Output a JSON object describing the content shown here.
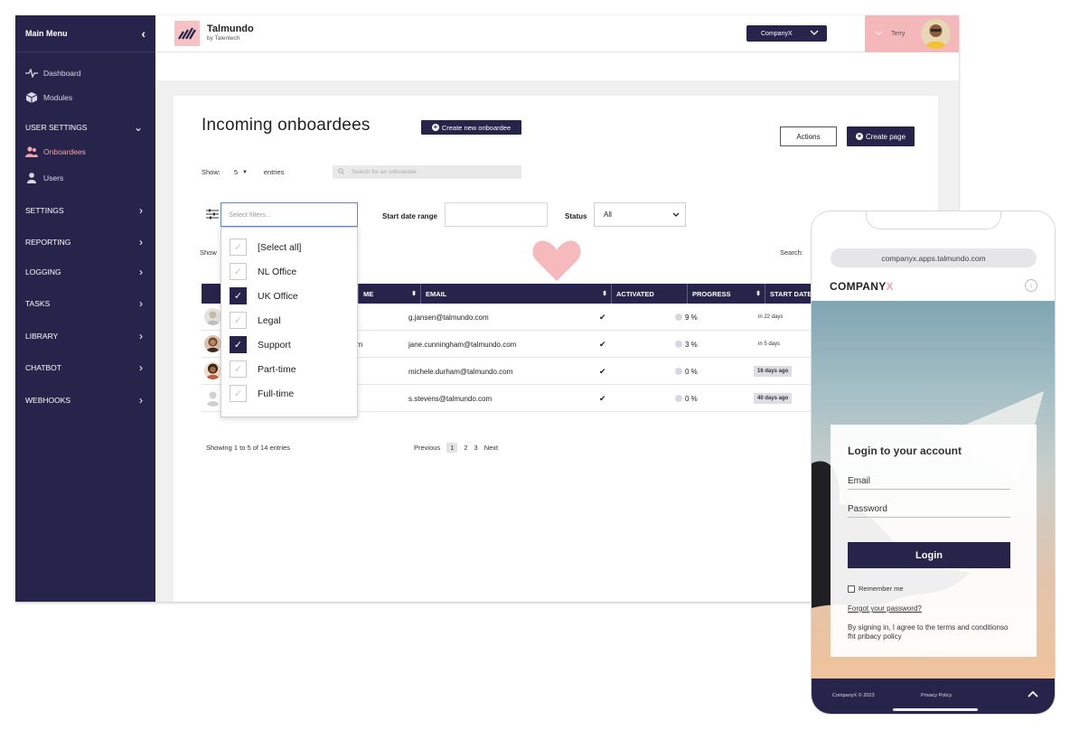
{
  "sidebar": {
    "title": "Main Menu",
    "items": [
      {
        "label": "Dashboard",
        "icon": "pulse-icon"
      },
      {
        "label": "Modules",
        "icon": "cube-icon"
      },
      {
        "label": "USER SETTINGS",
        "expanded": true
      },
      {
        "label": "Onboardees",
        "icon": "users-icon",
        "active": true
      },
      {
        "label": "Users",
        "icon": "user-icon"
      },
      {
        "label": "SETTINGS"
      },
      {
        "label": "REPORTING"
      },
      {
        "label": "LOGGING"
      },
      {
        "label": "TASKS"
      },
      {
        "label": "LIBRARY"
      },
      {
        "label": "CHATBOT"
      },
      {
        "label": "WEBHOOKS"
      }
    ]
  },
  "topbar": {
    "brand": "Talmundo",
    "brand_sub": "by Talentech",
    "company": "CompanyX",
    "user": "Terry"
  },
  "main": {
    "title": "Incoming onboardees",
    "create_onboardee": "Create new onboardee",
    "actions": "Actions",
    "create_page": "Create page",
    "show_label": "Show:",
    "show_value": "5",
    "entries_label": "entries",
    "search_placeholder": "Search for an onboardee",
    "filter_placeholder": "Select filters...",
    "start_date_label": "Start date range",
    "status_label": "Status",
    "status_value": "All",
    "show_partial": "Show",
    "search_label": "Search:"
  },
  "filter_options": [
    {
      "label": "[Select all]",
      "checked": false
    },
    {
      "label": "NL Office",
      "checked": false
    },
    {
      "label": "UK Office",
      "checked": true
    },
    {
      "label": "Legal",
      "checked": false
    },
    {
      "label": "Support",
      "checked": true
    },
    {
      "label": "Part-time",
      "checked": false
    },
    {
      "label": "Full-time",
      "checked": false
    }
  ],
  "table": {
    "columns": [
      "ME",
      "EMAIL",
      "ACTIVATED",
      "PROGRESS",
      "START DATE"
    ],
    "rows": [
      {
        "name_tail": "",
        "email": "g.jansen@talmundo.com",
        "activated": "✔",
        "progress": "9 %",
        "start": "in 22 days",
        "tagged": false
      },
      {
        "name_tail": "am",
        "email": "jane.cunningham@talmundo.com",
        "activated": "✔",
        "progress": "3 %",
        "start": "in 5 days",
        "tagged": false
      },
      {
        "name_tail": "",
        "email": "michele.durham@talmundo.com",
        "activated": "✔",
        "progress": "0 %",
        "start": "16 days ago",
        "tagged": true
      },
      {
        "name_tail": "",
        "email": "s.stevens@talmundo.com",
        "activated": "✔",
        "progress": "0 %",
        "start": "40 days ago",
        "tagged": true
      }
    ],
    "info": "Showing 1 to 5 of 14 entries",
    "pager": {
      "prev": "Previous",
      "pages": [
        "1",
        "2",
        "3"
      ],
      "next": "Next"
    }
  },
  "phone": {
    "url": "companyx.apps.talmundo.com",
    "logo_main": "COMPANY",
    "logo_x": "X",
    "login_title": "Login to your account",
    "email_label": "Email",
    "password_label": "Password",
    "login_button": "Login",
    "remember": "Remember me",
    "forgot": "Forgot your password?",
    "terms": "By signing in, I agree to the terms and conditionso fht pribacy policy",
    "footer_copy": "CompanyX © 2023",
    "footer_privacy": "Privacy Policy"
  },
  "colors": {
    "navy": "#26244a",
    "pink": "#f4a3a8",
    "accent_blue": "#5a8ad6"
  }
}
